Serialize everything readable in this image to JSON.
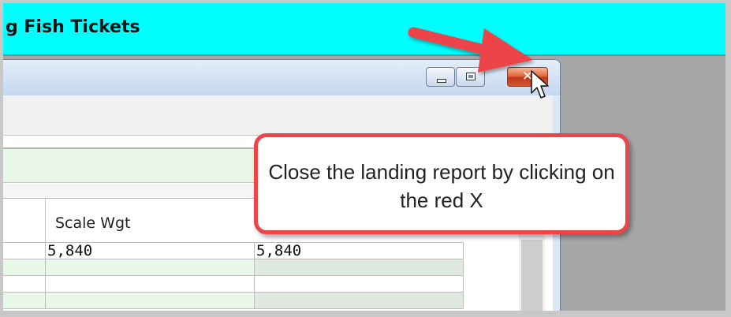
{
  "app": {
    "title": "g Fish Tickets"
  },
  "window": {
    "controls": {
      "minimize": "minimize",
      "maximize": "maximize",
      "close": "close"
    }
  },
  "grid": {
    "header": "Scale Wgt",
    "rows": [
      [
        "",
        "5,840",
        "5,840"
      ],
      [
        "",
        "",
        ""
      ],
      [
        "",
        "",
        ""
      ],
      [
        "",
        "",
        ""
      ]
    ]
  },
  "callout": {
    "text": "Close the landing report by clicking on the red X"
  },
  "colors": {
    "accent": "#ec4448",
    "header_bg": "#00ffff",
    "row_alt": "#e9f7e9"
  },
  "icons": [
    "minimize-icon",
    "maximize-icon",
    "close-icon",
    "cursor-icon",
    "red-arrow",
    "scroll-up-icon"
  ]
}
